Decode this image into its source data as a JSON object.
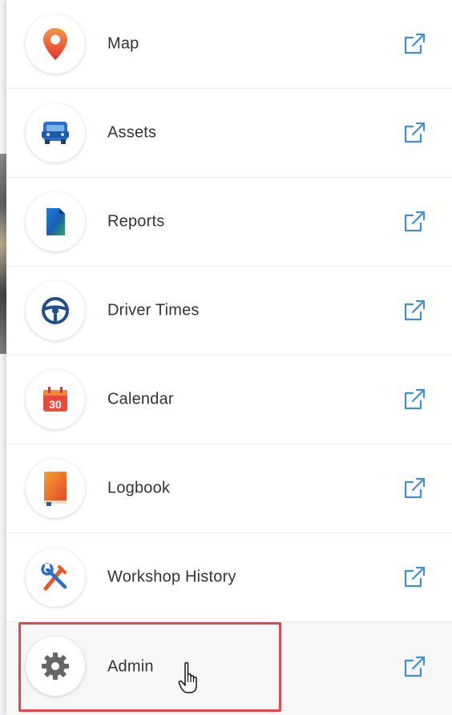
{
  "menu": {
    "items": [
      {
        "label": "Map",
        "icon": "map-pin-icon"
      },
      {
        "label": "Assets",
        "icon": "truck-icon"
      },
      {
        "label": "Reports",
        "icon": "report-document-icon"
      },
      {
        "label": "Driver Times",
        "icon": "steering-wheel-icon"
      },
      {
        "label": "Calendar",
        "icon": "calendar-icon",
        "icon_text": "30"
      },
      {
        "label": "Logbook",
        "icon": "logbook-icon"
      },
      {
        "label": "Workshop History",
        "icon": "tools-icon"
      },
      {
        "label": "Admin",
        "icon": "gear-icon"
      }
    ],
    "external_icon": "external-link-icon",
    "highlighted_item": "Admin"
  },
  "colors": {
    "label": "#333333",
    "external_link": "#3d8fd6",
    "highlight_border": "#e2474b",
    "map_pin": "#e8453c",
    "truck": "#2a6fc9",
    "steering": "#1f4f8a",
    "calendar": "#e84b3c",
    "logbook": "#f07a1a",
    "gear": "#666666"
  }
}
